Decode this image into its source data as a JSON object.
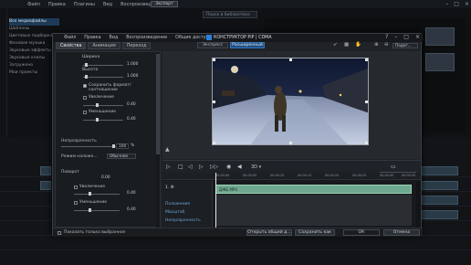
{
  "background_app": {
    "menu": [
      "Файл",
      "Правка",
      "Плагины",
      "Вид",
      "Воспроизведение"
    ],
    "top_button": "Экспорт",
    "search_placeholder": "Поиск в библиотеке",
    "tree": [
      "Все медиафайлы",
      "Шаблоны",
      "Цветовые подборки",
      "Фоновая музыка",
      "Звуковые эффекты",
      "Звуковые клипы",
      "Загружено",
      "Мои проекты"
    ]
  },
  "dialog": {
    "menu": [
      "Файл",
      "Правка",
      "Вид",
      "Воспроизведение",
      "Общие доступ"
    ],
    "title": "КОНСТРУКТОР PiP | CDMA",
    "tabs": [
      "Свойства",
      "Анимация",
      "Переход"
    ],
    "props": {
      "width_label": "Ширина",
      "width_value": "1.000",
      "height_label": "Высота",
      "height_value": "1.000",
      "keep_ratio_label": "Сохранить формат/соотношение",
      "increase_label": "Увеличение",
      "increase_value": "0.40",
      "decrease_label": "Уменьшение",
      "decrease_value": "0.40",
      "opacity_label": "Непрозрачность",
      "opacity_value": "100",
      "opacity_unit": "%",
      "blend_label": "Режим наложе...",
      "blend_value": "Обычное",
      "rotation_label": "Поворот",
      "rotation_value": "0.00",
      "rot_increase_label": "Увеличение",
      "rot_increase_value": "0.40",
      "rot_decrease_label": "Уменьшение",
      "rot_decrease_value": "0.40"
    },
    "mode_express": "Экспресс",
    "mode_advanced": "Расширенный",
    "zoom_dropdown": "Подог...",
    "timeline": {
      "ruler": [
        "00:00:00",
        "00:00:05",
        "00:00:10",
        "00:00:15",
        "00:00:20",
        "00:00:25",
        "00:00:30",
        "00:00:35"
      ],
      "track_label": "1. Ф",
      "clip_label": "ДЖБ.МР4",
      "rows": [
        "Положение",
        "Масштаб",
        "Непрозрачность"
      ]
    },
    "show_selected_only": "Показать только выбранное",
    "buttons": {
      "open_shared": "Открыть общий д...",
      "save_as": "Сохранить как",
      "ok": "ОК",
      "cancel": "Отмена"
    }
  }
}
